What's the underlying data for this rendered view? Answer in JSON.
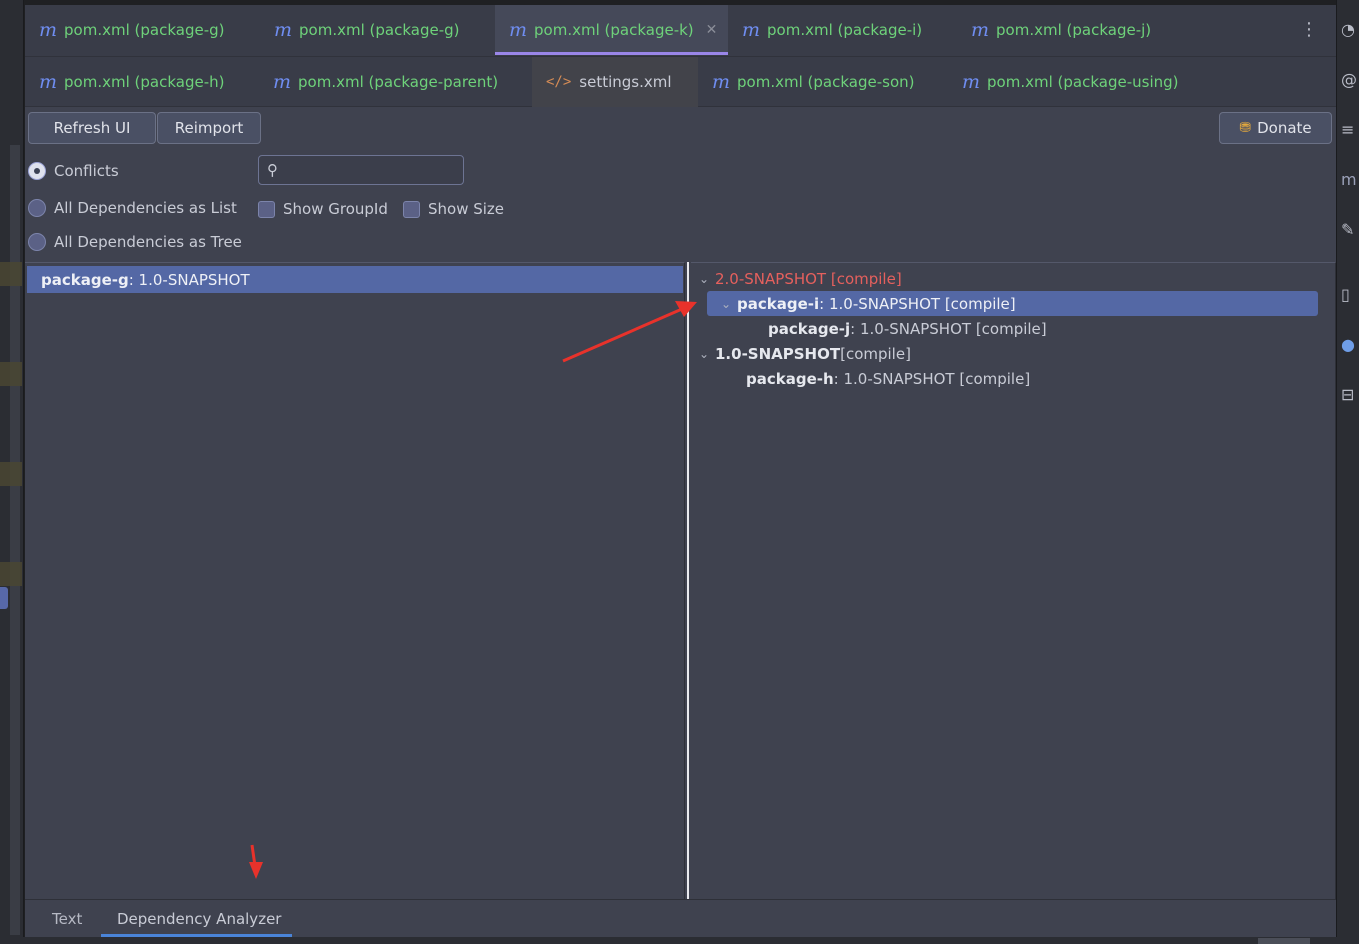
{
  "tabs_row1": [
    {
      "label": "pom.xml (package-g)",
      "icon": "maven-m-icon"
    },
    {
      "label": "pom.xml (package-g)",
      "icon": "maven-m-icon"
    },
    {
      "label": "pom.xml (package-k)",
      "icon": "maven-m-icon",
      "active": true
    },
    {
      "label": "pom.xml (package-i)",
      "icon": "maven-m-icon"
    },
    {
      "label": "pom.xml (package-j)",
      "icon": "maven-m-icon"
    }
  ],
  "tabs_row2": [
    {
      "label": "pom.xml (package-h)",
      "icon": "maven-m-icon"
    },
    {
      "label": "pom.xml (package-parent)",
      "icon": "maven-m-icon"
    },
    {
      "label": "settings.xml",
      "icon": "xml-code-icon"
    },
    {
      "label": "pom.xml (package-son)",
      "icon": "maven-m-icon"
    },
    {
      "label": "pom.xml (package-using)",
      "icon": "maven-m-icon"
    }
  ],
  "glyphs": {
    "maven": "m",
    "xml": "</>",
    "close": "✕",
    "kebab": "⋮",
    "search": "⚲",
    "chevron": "⌄",
    "donate": "⛃"
  },
  "toolbar": {
    "refresh_label": "Refresh UI",
    "reimport_label": "Reimport",
    "donate_label": "Donate"
  },
  "filters": {
    "conflicts_label": "Conflicts",
    "list_label": "All Dependencies as List",
    "tree_label": "All Dependencies as Tree",
    "show_groupid_label": "Show GroupId",
    "show_size_label": "Show Size",
    "selected_mode": "Conflicts"
  },
  "search": {
    "value": "",
    "placeholder": ""
  },
  "left_list": [
    {
      "name": "package-g",
      "version": " : 1.0-SNAPSHOT"
    }
  ],
  "tree": [
    {
      "label": "2.0-SNAPSHOT [compile]",
      "conflict": true
    },
    {
      "name": "package-i",
      "rest": " : 1.0-SNAPSHOT [compile]"
    },
    {
      "name": "package-j",
      "rest": " : 1.0-SNAPSHOT [compile]"
    },
    {
      "name": "1.0-SNAPSHOT",
      "rest": " [compile]"
    },
    {
      "name": "package-h",
      "rest": " : 1.0-SNAPSHOT [compile]"
    }
  ],
  "bottom_tabs": [
    {
      "label": "Text"
    },
    {
      "label": "Dependency Analyzer",
      "active": true
    }
  ],
  "colors": {
    "accent": "#9a86e8",
    "selection": "#5468a5",
    "conflict_text": "#e5605d",
    "maven_tab_text": "#6ed27a",
    "annotation_arrow": "#e8322b"
  }
}
